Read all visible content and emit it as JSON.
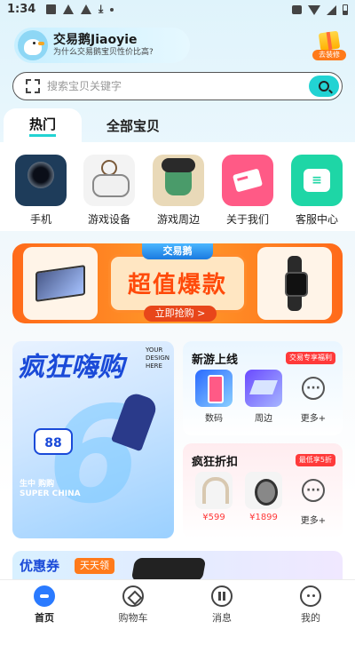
{
  "status": {
    "time": "1:34"
  },
  "brand": {
    "title": "交易鹅Jiaoyie",
    "subtitle": "为什么交易鹅宝贝性价比高?"
  },
  "gift": {
    "label": "去装修"
  },
  "search": {
    "placeholder": "搜索宝贝关键字"
  },
  "tabs": [
    {
      "label": "热门"
    },
    {
      "label": "全部宝贝"
    }
  ],
  "categories": [
    {
      "label": "手机",
      "icon": "phone-icon"
    },
    {
      "label": "游戏设备",
      "icon": "gamepad-icon"
    },
    {
      "label": "游戏周边",
      "icon": "figure-icon"
    },
    {
      "label": "关于我们",
      "icon": "card-icon"
    },
    {
      "label": "客服中心",
      "icon": "chat-icon"
    }
  ],
  "banner": {
    "tag": "交易鹅",
    "headline": "超值爆款",
    "button": "立即抢购 >"
  },
  "promo": {
    "title": "疯狂嗨购",
    "side": "YOUR DESIGN HERE",
    "badge": "88",
    "bottom": "生中 购购 SUPER CHINA"
  },
  "new_games": {
    "title": "新游上线",
    "tag": "交易专享福利",
    "items": [
      {
        "label": "数码"
      },
      {
        "label": "周边"
      },
      {
        "label": "更多+"
      }
    ]
  },
  "discount": {
    "title": "疯狂折扣",
    "tag": "最低享5折",
    "items": [
      {
        "price": "¥599"
      },
      {
        "price": "¥1899"
      },
      {
        "label": "更多+"
      }
    ]
  },
  "coupon": {
    "title": "优惠券",
    "tag": "天天领"
  },
  "nav": [
    {
      "label": "首页",
      "icon": "home-icon"
    },
    {
      "label": "购物车",
      "icon": "cart-icon"
    },
    {
      "label": "消息",
      "icon": "message-icon"
    },
    {
      "label": "我的",
      "icon": "profile-icon"
    }
  ],
  "colors": {
    "accent": "#22d3d3",
    "orange": "#ff6a1a",
    "blue": "#1a4ad8",
    "red": "#ff3a3a"
  }
}
